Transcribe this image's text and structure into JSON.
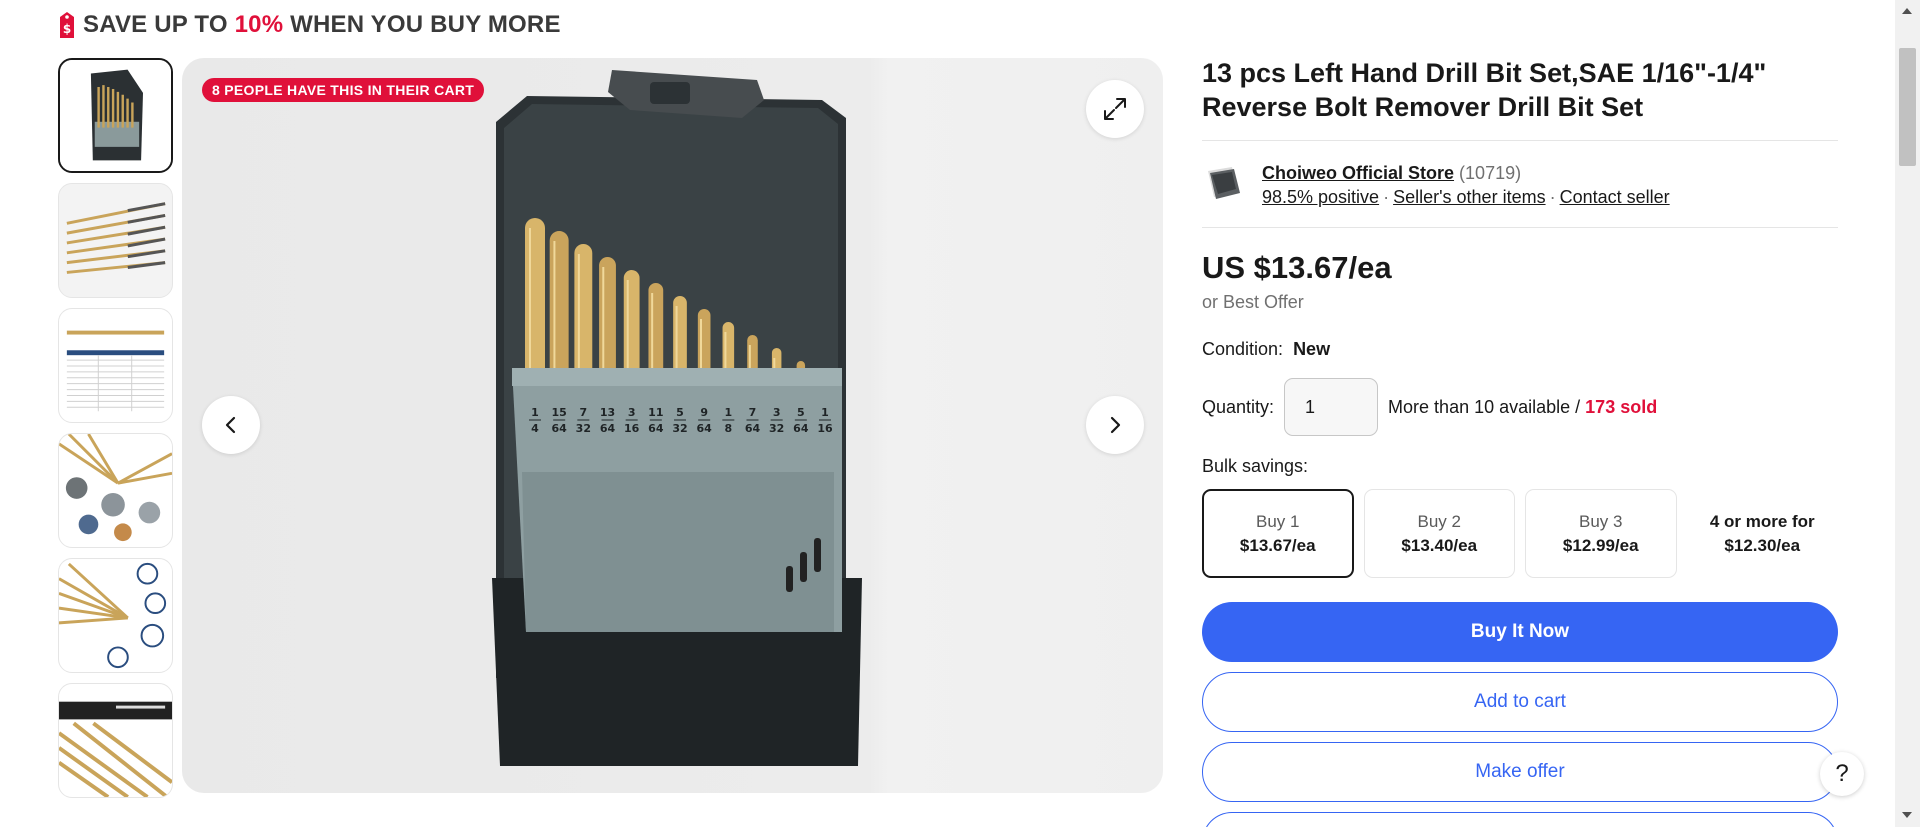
{
  "promo": {
    "prefix": "SAVE UP TO",
    "percent": "10%",
    "suffix": "WHEN YOU BUY MORE"
  },
  "gallery": {
    "cart_badge": "8 PEOPLE HAVE THIS IN THEIR CART",
    "thumbnail_count": 6,
    "active_thumbnail": 1,
    "drill_labels_top": [
      "1",
      "15",
      "7",
      "13",
      "3",
      "11",
      "5",
      "9",
      "1",
      "7",
      "3",
      "5",
      "1"
    ],
    "drill_labels_bottom": [
      "4",
      "64",
      "32",
      "64",
      "16",
      "64",
      "32",
      "64",
      "8",
      "64",
      "32",
      "64",
      "16"
    ]
  },
  "product": {
    "title": "13 pcs Left Hand Drill Bit Set,SAE 1/16\"-1/4\" Reverse Bolt Remover Drill Bit Set"
  },
  "seller": {
    "name": "Choiweo Official Store",
    "feedback_count": "(10719)",
    "positive": "98.5% positive",
    "other_items": "Seller's other items",
    "contact": "Contact seller"
  },
  "pricing": {
    "price": "US $13.67/ea",
    "best_offer": "or Best Offer"
  },
  "condition": {
    "label": "Condition:",
    "value": "New"
  },
  "quantity": {
    "label": "Quantity:",
    "value": "1",
    "availability": "More than 10 available /",
    "sold": "173 sold"
  },
  "bulk": {
    "label": "Bulk savings:",
    "options": [
      {
        "qty": "Buy 1",
        "price": "$13.67/ea",
        "selected": true
      },
      {
        "qty": "Buy 2",
        "price": "$13.40/ea",
        "selected": false
      },
      {
        "qty": "Buy 3",
        "price": "$12.99/ea",
        "selected": false
      },
      {
        "qty": "4 or more for",
        "price": "$12.30/ea",
        "selected": false
      }
    ]
  },
  "actions": {
    "buy_now": "Buy It Now",
    "add_to_cart": "Add to cart",
    "make_offer": "Make offer"
  },
  "help": {
    "label": "?"
  },
  "colors": {
    "accent": "#3665f3",
    "promo_red": "#e0103a",
    "text": "#191919"
  }
}
